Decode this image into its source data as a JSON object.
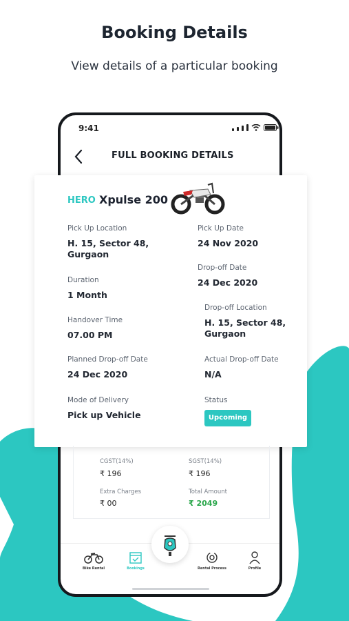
{
  "promo": {
    "title": "Booking Details",
    "subtitle": "View details of a particular booking"
  },
  "status_bar": {
    "time": "9:41"
  },
  "header": {
    "title": "FULL BOOKING DETAILS",
    "back_icon": "chevron-left-icon"
  },
  "vehicle": {
    "brand": "HERO",
    "model": "Xpulse 200",
    "image": "motorcycle-image"
  },
  "details": {
    "pickup_location_label": "Pick Up Location",
    "pickup_location_line1": "H. 15, Sector 48,",
    "pickup_location_line2": "Gurgaon",
    "pickup_date_label": "Pick Up Date",
    "pickup_date": "24 Nov 2020",
    "dropoff_date_label": "Drop-off  Date",
    "dropoff_date": "24 Dec 2020",
    "duration_label": "Duration",
    "duration": "1 Month",
    "handover_time_label": "Handover Time",
    "handover_time": "07.00 PM",
    "dropoff_location_label": "Drop-off Location",
    "dropoff_location_line1": "H. 15, Sector 48,",
    "dropoff_location_line2": "Gurgaon",
    "planned_dropoff_label": "Planned Drop-off Date",
    "planned_dropoff": "24 Dec 2020",
    "actual_dropoff_label": "Actual Drop-off Date",
    "actual_dropoff": "N/A",
    "delivery_mode_label": "Mode of Delivery",
    "delivery_mode": "Pick up Vehicle",
    "status_label": "Status",
    "status": "Upcoming"
  },
  "fare": {
    "cgst_label": "CGST(14%)",
    "cgst_value": "₹ 196",
    "sgst_label": "SGST(14%)",
    "sgst_value": "₹ 196",
    "extra_label": "Extra Charges",
    "extra_value": "₹ 00",
    "total_label": "Total Amount",
    "total_value": "₹ 2049"
  },
  "bottom_nav": {
    "items": [
      {
        "label": "Bike Rental",
        "icon": "bike-icon"
      },
      {
        "label": "Bookings",
        "icon": "calendar-check-icon"
      },
      {
        "label": "Rental Process",
        "icon": "process-cycle-icon"
      },
      {
        "label": "Profile",
        "icon": "user-icon"
      }
    ],
    "center_icon": "scooter-icon"
  },
  "colors": {
    "accent": "#2cc7c1",
    "dark": "#1d2530",
    "total_green": "#29a64a"
  }
}
